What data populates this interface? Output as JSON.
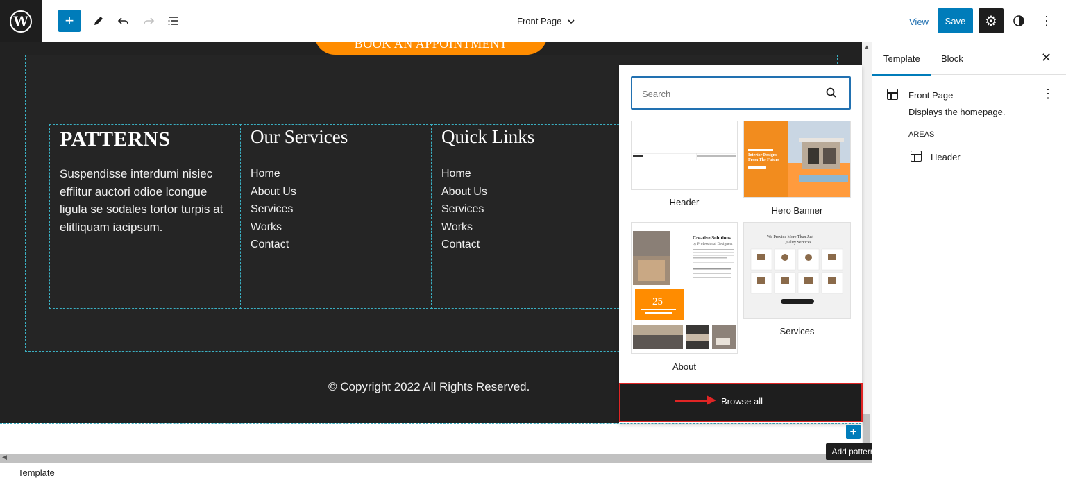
{
  "topbar": {
    "logo_letter": "W",
    "add_icon": "plus-icon",
    "edit_icon": "pencil-icon",
    "undo_icon": "undo-icon",
    "redo_icon": "redo-icon",
    "list_icon": "list-view-icon",
    "document_title": "Front Page",
    "view_label": "View",
    "save_label": "Save",
    "colors": {
      "primary": "#007cba",
      "dark": "#1e1e1e"
    }
  },
  "canvas": {
    "appointment_button": "BOOK AN APPOINTMENT",
    "footer": {
      "brand": "PATTERNS",
      "description": "Suspendisse interdumi nisiec effiitur auctori odioe lcongue ligula se sodales tortor turpis at elitliquam iacipsum.",
      "services_heading": "Our Services",
      "services_links": [
        "Home",
        "About Us",
        "Services",
        "Works",
        "Contact"
      ],
      "quicklinks_heading": "Quick Links",
      "quick_links": [
        "Home",
        "About Us",
        "Services",
        "Works",
        "Contact"
      ],
      "copyright": "© Copyright 2022 All Rights Reserved.",
      "accent": "#ff8c00"
    }
  },
  "patterns_popover": {
    "search_placeholder": "Search",
    "patterns": [
      {
        "label": "Header"
      },
      {
        "label": "Hero Banner",
        "thumb_heading": "Interior Designs From The Future"
      },
      {
        "label": "About",
        "thumb_heading": "Creative Solutions",
        "thumb_sub": "by Professional Designers",
        "thumb_number": "25"
      },
      {
        "label": "Services",
        "thumb_heading": "We Provide More Than Just Quality Services"
      }
    ],
    "browse_all_label": "Browse all"
  },
  "add_pattern": {
    "tooltip": "Add pattern"
  },
  "sidebar": {
    "tabs": [
      "Template",
      "Block"
    ],
    "template_name": "Front Page",
    "template_description": "Displays the homepage.",
    "areas_label": "AREAS",
    "areas": [
      "Header"
    ]
  },
  "statusbar": {
    "label": "Template"
  }
}
